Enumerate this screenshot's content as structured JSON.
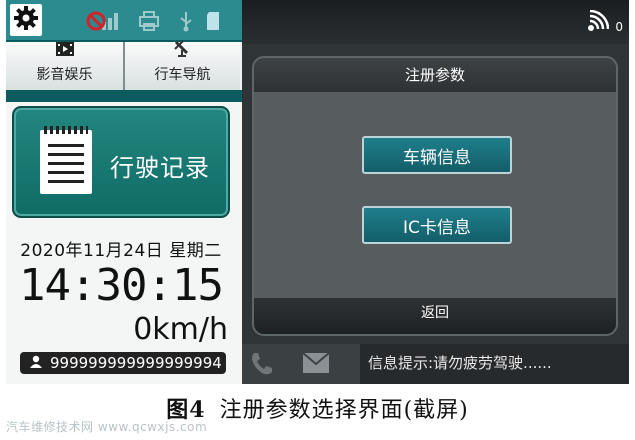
{
  "left_panel": {
    "media_buttons": [
      {
        "label": "影音娱乐",
        "icon": "film-icon"
      },
      {
        "label": "行车导航",
        "icon": "satellite-icon"
      }
    ],
    "drive_record_label": "行驶记录",
    "date": "2020年11月24日 星期二",
    "time": "14:30:15",
    "speed": "0km/h",
    "driver_id": "999999999999999994"
  },
  "top_bar": {
    "signal_count": "0"
  },
  "dialog": {
    "title": "注册参数",
    "buttons": [
      "车辆信息",
      "IC卡信息"
    ],
    "back_label": "返回"
  },
  "bottom_bar": {
    "info_text": "信息提示:请勿疲劳驾驶......"
  },
  "caption": {
    "figure_num": "图4",
    "text": "注册参数选择界面(截屏)"
  },
  "watermark": "汽车维修技术网 www.qcwxjs.com",
  "colors": {
    "teal_status": "#2b8b8f",
    "teal_button": "#1f7e8c",
    "panel_dark": "#2f3436"
  }
}
